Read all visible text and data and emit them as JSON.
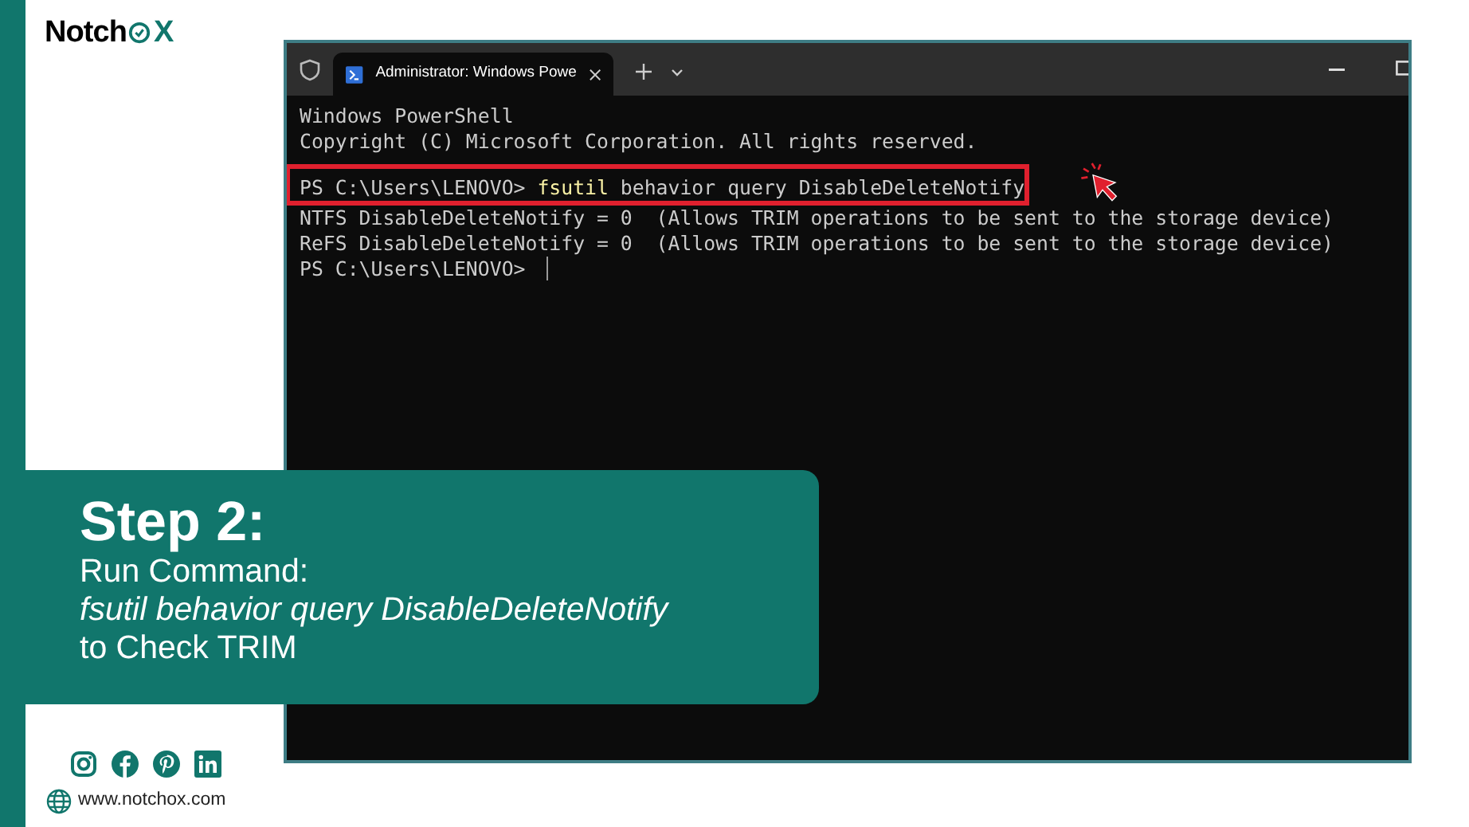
{
  "logo": {
    "text_before": "Notch",
    "text_after": "X"
  },
  "terminal": {
    "tab_title": "Administrator: Windows Powe",
    "lines": [
      {
        "kind": "text",
        "text": "Windows PowerShell"
      },
      {
        "kind": "text",
        "text": "Copyright (C) Microsoft Corporation. All rights reserved."
      },
      {
        "kind": "blank"
      },
      {
        "kind": "prompt",
        "prompt": "PS C:\\Users\\LENOVO>",
        "command": "fsutil",
        "args": "behavior query DisableDeleteNotify",
        "highlighted": true
      },
      {
        "kind": "text",
        "text": "NTFS DisableDeleteNotify = 0  (Allows TRIM operations to be sent to the storage device)"
      },
      {
        "kind": "text",
        "text": "ReFS DisableDeleteNotify = 0  (Allows TRIM operations to be sent to the storage device)"
      },
      {
        "kind": "prompt",
        "prompt": "PS C:\\Users\\LENOVO>",
        "cursor": true,
        "highlighted": false
      }
    ]
  },
  "step": {
    "title": "Step 2:",
    "lines": [
      {
        "kind": "plain",
        "text": "Run Command:"
      },
      {
        "kind": "italic",
        "text": "fsutil behavior query DisableDeleteNotify"
      },
      {
        "kind": "plain",
        "text": "to Check TRIM"
      }
    ]
  },
  "footer": {
    "social": [
      {
        "kind": "instagram"
      },
      {
        "kind": "facebook"
      },
      {
        "kind": "pinterest"
      },
      {
        "kind": "linkedin"
      }
    ],
    "website": "www.notchox.com"
  }
}
